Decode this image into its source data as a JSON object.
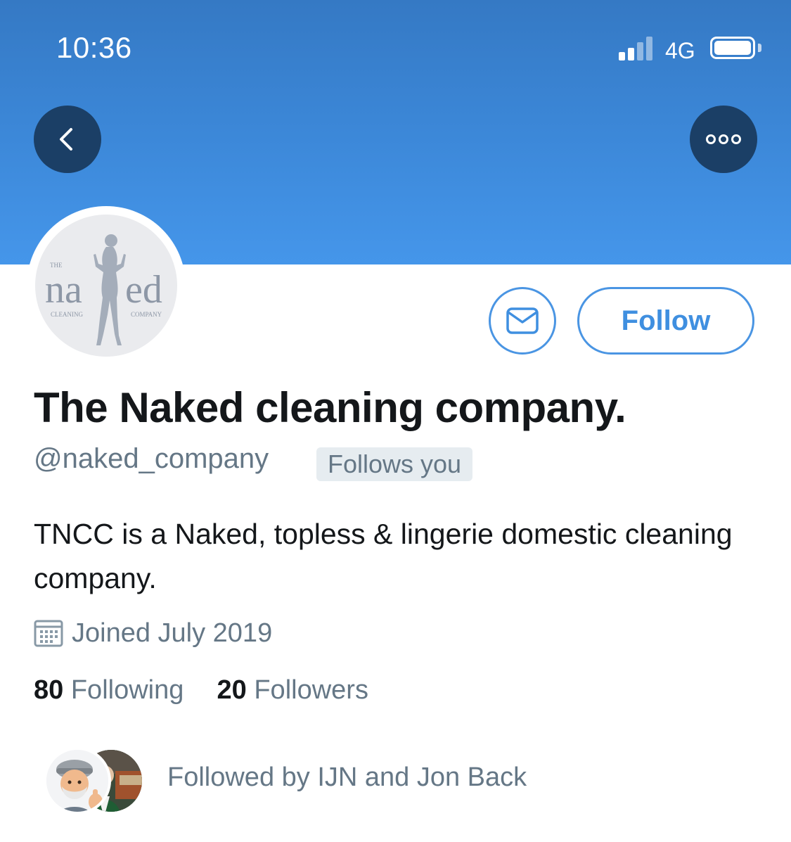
{
  "status_bar": {
    "time": "10:36",
    "network": "4G",
    "signal_bars_filled": 2,
    "signal_bars_total": 4
  },
  "header": {
    "back_icon": "chevron-left-icon",
    "more_icon": "ellipsis-icon"
  },
  "profile": {
    "avatar_logo": {
      "small_top": "THE",
      "main_left": "na",
      "main_right": "ed",
      "bottom_left": "CLEANING",
      "bottom_right": "COMPANY"
    },
    "display_name": "The Naked cleaning company.",
    "handle": "@naked_company",
    "follows_you_badge": "Follows you",
    "bio": "TNCC is a Naked, topless & lingerie domestic cleaning company.",
    "joined": "Joined July 2019",
    "following_count": "80",
    "following_label": "Following",
    "followers_count": "20",
    "followers_label": "Followers",
    "followed_by": "Followed by IJN and Jon Back"
  },
  "actions": {
    "message_icon": "envelope-icon",
    "follow_label": "Follow"
  },
  "colors": {
    "accent": "#4a95e3",
    "header_top": "#3579c4",
    "header_bottom": "#4596ea",
    "round_button": "#1b3f66",
    "primary_text": "#14171a",
    "secondary_text": "#657786"
  }
}
